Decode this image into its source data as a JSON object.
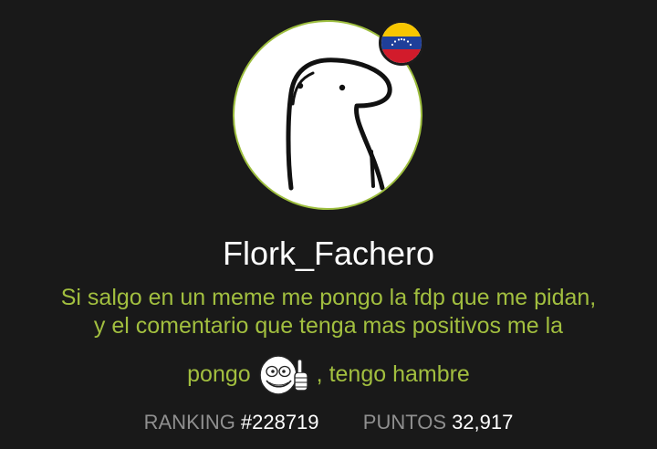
{
  "profile": {
    "username": "Flork_Fachero",
    "bio_line_1": "Si salgo en un meme me pongo la fdp que me pidan,",
    "bio_line_2": "y el comentario que tenga mas positivos me la",
    "bio_line_3_start": "pongo",
    "bio_line_3_end": ", tengo hambre",
    "flag_icon": "venezuela-flag-icon",
    "emoji_icon": "thumbs-up-rage-face-icon"
  },
  "stats": {
    "ranking_label": "RANKING",
    "ranking_value": "#228719",
    "points_label": "PUNTOS",
    "points_value": "32,917"
  },
  "colors": {
    "background": "#191919",
    "bio_text": "#a2bf3f",
    "avatar_border": "#9cbd3d",
    "label_gray": "#8f8f8f"
  }
}
